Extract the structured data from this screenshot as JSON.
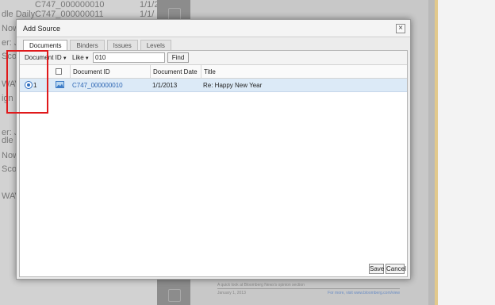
{
  "background": {
    "rows": [
      {
        "left": "",
        "id": "C747_000000010",
        "date": "1/1/2"
      },
      {
        "left": "dle Daily",
        "id": "C747_000000011",
        "date": "1/1/"
      },
      {
        "left": "Now",
        "id": "",
        "date": ""
      },
      {
        "left": "er: Ja",
        "id": "",
        "date": ""
      },
      {
        "left": "Scor",
        "id": "",
        "date": ""
      },
      {
        "left": "WAV",
        "id": "",
        "date": ""
      },
      {
        "left": "ign C",
        "id": "",
        "date": ""
      },
      {
        "left": "er: Ja",
        "id": "",
        "date": ""
      },
      {
        "left": "dle Da",
        "id": "",
        "date": ""
      },
      {
        "left": "Now",
        "id": "",
        "date": ""
      },
      {
        "left": "Scor",
        "id": "",
        "date": ""
      },
      {
        "left": "WAV",
        "id": "",
        "date": ""
      }
    ],
    "footer": {
      "line1": "A quick look at Bloomberg News's opinion section",
      "date": "January 1, 2013",
      "more": "For more, visit www.bloomberg.com/view"
    }
  },
  "dialog": {
    "title": "Add Source",
    "close_icon": "×",
    "tabs": [
      {
        "label": "Documents",
        "active": true
      },
      {
        "label": "Binders",
        "active": false
      },
      {
        "label": "Issues",
        "active": false
      },
      {
        "label": "Levels",
        "active": false
      }
    ],
    "filter": {
      "field_label": "Document ID",
      "operator_label": "Like",
      "value": "010",
      "find_label": "Find",
      "caret": "▼"
    },
    "table": {
      "columns": [
        "Document ID",
        "Document Date",
        "Title"
      ],
      "rows": [
        {
          "num": "1",
          "doc_id": "C747_000000010",
          "date": "1/1/2013",
          "title": "Re: Happy New Year",
          "selected": true
        }
      ]
    },
    "save_label": "Save",
    "cancel_label": "Cancel"
  },
  "colors": {
    "highlight": "#e0191b",
    "link": "#2a64b3",
    "selected_row": "#dceaf7"
  }
}
